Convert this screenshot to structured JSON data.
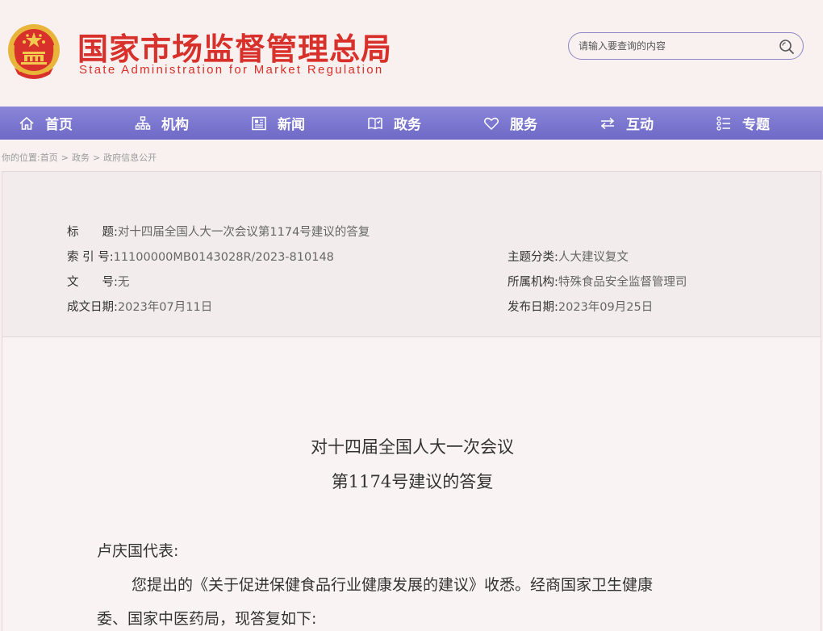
{
  "header": {
    "title_cn": "国家市场监督管理总局",
    "title_en": "State Administration for Market Regulation",
    "brand_color": "#d8302a"
  },
  "search": {
    "placeholder": "请输入要查询的内容",
    "icon": "search-icon"
  },
  "nav": {
    "items": [
      {
        "label": "首页",
        "icon": "home-icon"
      },
      {
        "label": "机构",
        "icon": "org-chart-icon"
      },
      {
        "label": "新闻",
        "icon": "newspaper-icon"
      },
      {
        "label": "政务",
        "icon": "book-icon"
      },
      {
        "label": "服务",
        "icon": "heart-icon"
      },
      {
        "label": "互动",
        "icon": "swap-arrows-icon"
      },
      {
        "label": "专题",
        "icon": "list-icon"
      }
    ],
    "color": "#7a76d0"
  },
  "breadcrumb": {
    "prefix": "你的位置:",
    "items": [
      "首页",
      "政务",
      "政府信息公开"
    ],
    "separator": ">"
  },
  "meta": {
    "title_label": "标　　题:",
    "title_value": "对十四届全国人大一次会议第1174号建议的答复",
    "index_label": "索 引 号:",
    "index_value": "11100000MB0143028R/2023-810148",
    "category_label": "主题分类:",
    "category_value": "人大建议复文",
    "docno_label": "文　　号:",
    "docno_value": "无",
    "org_label": "所属机构:",
    "org_value": "特殊食品安全监督管理司",
    "created_label": "成文日期:",
    "created_value": "2023年07月11日",
    "published_label": "发布日期:",
    "published_value": "2023年09月25日"
  },
  "article": {
    "title_line1": "对十四届全国人大一次会议",
    "title_line2": "第1174号建议的答复",
    "salutation": "卢庆国代表:",
    "para1_line1": "您提出的《关于促进保健食品行业健康发展的建议》收悉。经商国家卫生健康",
    "para1_line2": "委、国家中医药局，现答复如下:"
  }
}
